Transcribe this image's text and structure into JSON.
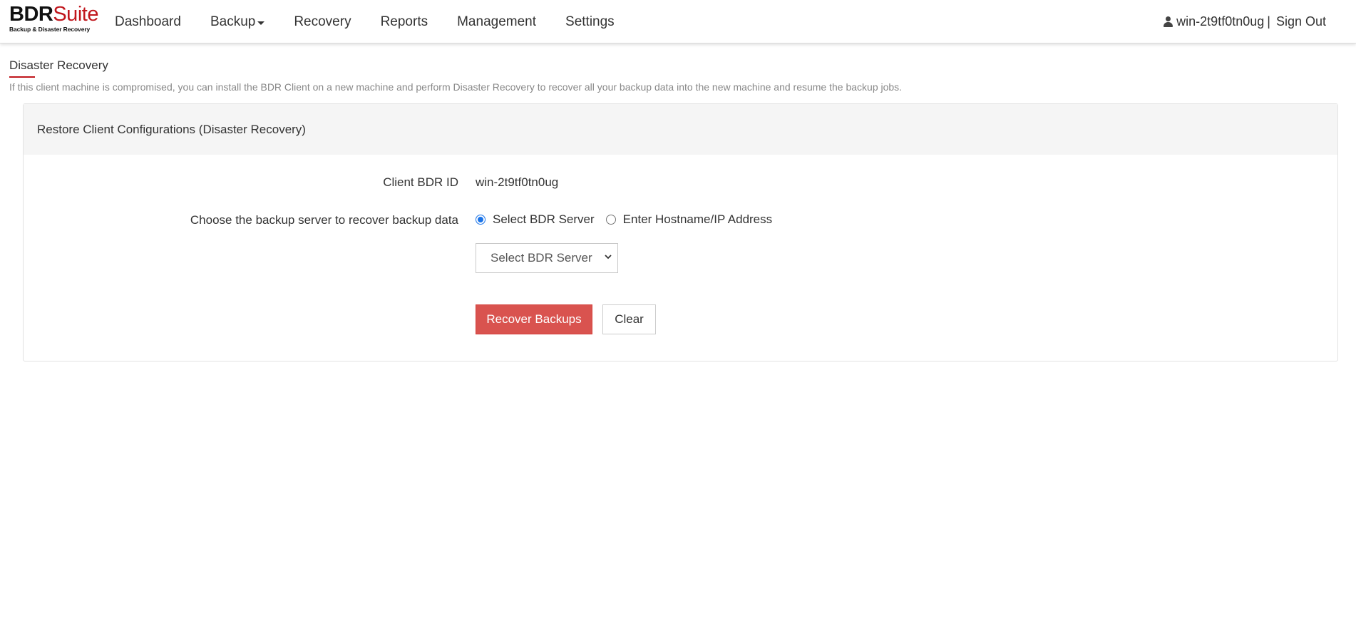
{
  "logo": {
    "brand_bold": "BDR",
    "brand_accent": "Suite",
    "tagline": "Backup & Disaster Recovery"
  },
  "nav": {
    "items": [
      {
        "label": "Dashboard"
      },
      {
        "label": "Backup",
        "has_dropdown": true
      },
      {
        "label": "Recovery"
      },
      {
        "label": "Reports"
      },
      {
        "label": "Management"
      },
      {
        "label": "Settings"
      }
    ]
  },
  "user": {
    "icon": "user-icon",
    "name": "win-2t9tf0tn0ug",
    "separator": "|",
    "signout_label": "Sign Out"
  },
  "page": {
    "title": "Disaster Recovery",
    "description": "If this client machine is compromised, you can install the BDR Client on a new machine and perform Disaster Recovery to recover all your backup data into the new machine and resume the backup jobs."
  },
  "panel": {
    "heading": "Restore Client Configurations (Disaster Recovery)",
    "client_id_label": "Client BDR ID",
    "client_id_value": "win-2t9tf0tn0ug",
    "server_choice_label": "Choose the backup server to recover backup data",
    "radio_options": [
      {
        "label": "Select BDR Server",
        "checked": true
      },
      {
        "label": "Enter Hostname/IP Address",
        "checked": false
      }
    ],
    "server_select": {
      "selected": "Select BDR Server"
    },
    "recover_button": "Recover Backups",
    "clear_button": "Clear"
  },
  "colors": {
    "accent": "#c0161c",
    "primary_button": "#d9534f",
    "radio_checked": "#1a73e8"
  }
}
